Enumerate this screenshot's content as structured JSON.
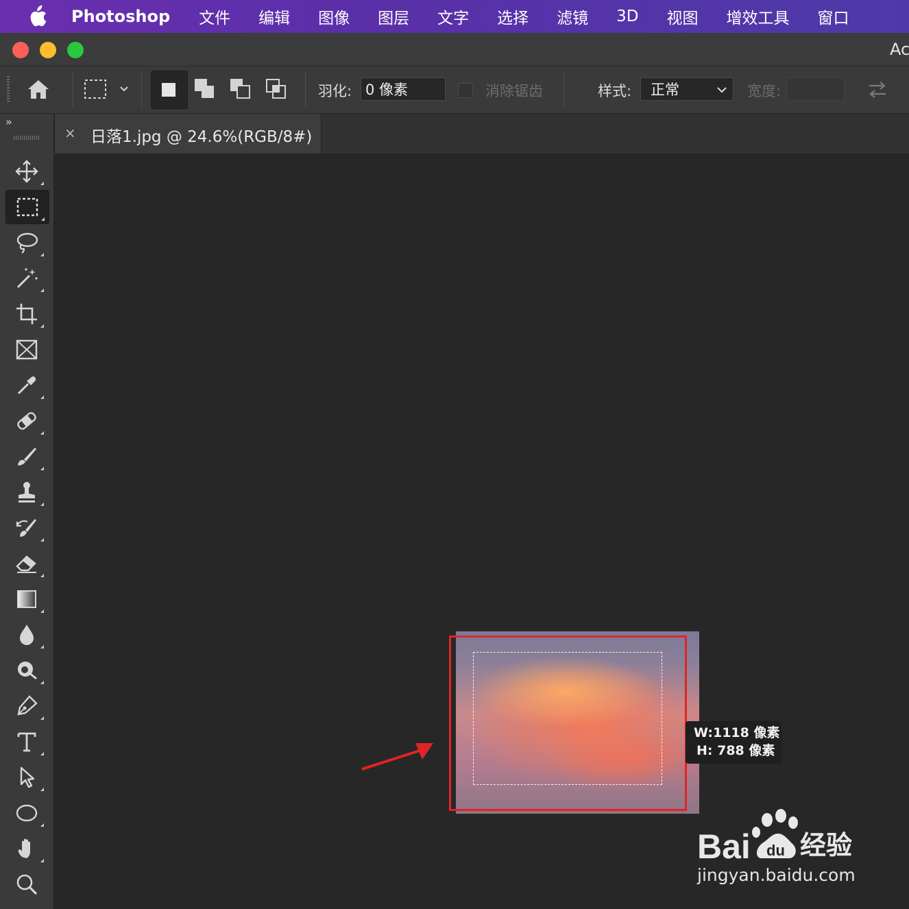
{
  "menubar": {
    "app_name": "Photoshop",
    "items": [
      "文件",
      "编辑",
      "图像",
      "图层",
      "文字",
      "选择",
      "滤镜",
      "3D",
      "视图",
      "增效工具",
      "窗口"
    ]
  },
  "window": {
    "title_partial": "Ac"
  },
  "options_bar": {
    "feather_label": "羽化:",
    "feather_value": "0 像素",
    "antialias_label": "消除锯齿",
    "style_label": "样式:",
    "style_value": "正常",
    "width_label": "宽度:",
    "width_value": ""
  },
  "document": {
    "tab_title": "日落1.jpg @ 24.6%(RGB/8#)",
    "tab_close": "×"
  },
  "selection_tooltip": {
    "width_text": "W:1118 像素",
    "height_text": "H: 788 像素"
  },
  "toolbar": {
    "collapse_glyph": "»",
    "tools": [
      "move",
      "rectangular-marquee",
      "lasso",
      "magic-wand",
      "crop",
      "frame",
      "eyedropper",
      "healing-brush",
      "brush",
      "clone-stamp",
      "history-brush",
      "eraser",
      "gradient",
      "blur",
      "dodge",
      "pen",
      "type",
      "path-selection",
      "ellipse",
      "hand",
      "zoom"
    ],
    "active_tool": "rectangular-marquee"
  },
  "watermark": {
    "brand": "Bai",
    "brand_suffix": "经验",
    "url": "jingyan.baidu.com"
  },
  "colors": {
    "menubar": "#5a2fa8",
    "highlight_box": "#e02424",
    "arrow": "#e02424"
  }
}
